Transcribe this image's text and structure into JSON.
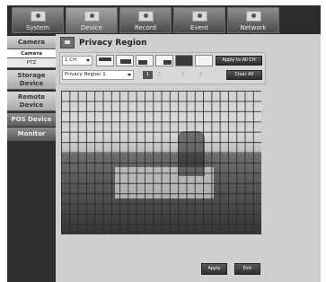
{
  "nav": {
    "tabs": [
      {
        "label": "System",
        "icon": "system-icon",
        "active": false
      },
      {
        "label": "Device",
        "icon": "device-icon",
        "active": true
      },
      {
        "label": "Record",
        "icon": "record-icon",
        "active": false
      },
      {
        "label": "Event",
        "icon": "event-icon",
        "active": false
      },
      {
        "label": "Network",
        "icon": "network-icon",
        "active": false
      }
    ]
  },
  "sidebar": {
    "items": [
      {
        "label": "Camera"
      },
      {
        "label": "Camera"
      },
      {
        "label": "PTZ"
      },
      {
        "label": "Storage Device"
      },
      {
        "label": "Remote Device"
      },
      {
        "label": "POS Device"
      },
      {
        "label": "Monitor"
      }
    ]
  },
  "page": {
    "title": "Privacy Region",
    "channel_select": "1 CH",
    "region_select": "Privacy Region 1",
    "region_numbers": [
      "1",
      "2",
      "3",
      "4"
    ],
    "active_region": "1",
    "apply_all_label": "Apply to All CH",
    "clear_all_label": "Clear All",
    "apply_label": "Apply",
    "exit_label": "Exit"
  },
  "colors": {
    "nav_bg": "#2b2b2b",
    "panel_bg": "#cfcfcf",
    "button_dark": "#2e2e2e"
  }
}
